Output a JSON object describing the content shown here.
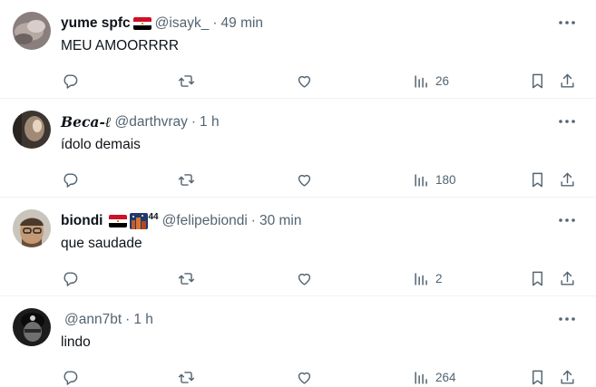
{
  "tweets": [
    {
      "name": "yume spfc",
      "handle": "@isayk_",
      "sep": "·",
      "time": "49 min",
      "text": "MEU AMOORRRR",
      "views": "26",
      "flags": [
        "egypt-flag"
      ]
    },
    {
      "name": "𝑩𝒆𝒄𝒂-ℓ",
      "handle": "@darthvray",
      "sep": "·",
      "time": "1 h",
      "text": "ídolo demais",
      "views": "180",
      "flags": []
    },
    {
      "name": "biondi",
      "handle": "@felipebiondi",
      "sep": "·",
      "time": "30 min",
      "text": "que saudade",
      "views": "2",
      "badge": "44",
      "flags": [
        "egypt-flag",
        "city-emoji"
      ]
    },
    {
      "name": "",
      "handle": "@ann7bt",
      "sep": "·",
      "time": "1 h",
      "text": "lindo",
      "views": "264",
      "flags": []
    }
  ],
  "icons": {
    "more": "more-icon",
    "reply": "reply-icon",
    "retweet": "retweet-icon",
    "like": "like-icon",
    "views": "views-icon",
    "bookmark": "bookmark-icon",
    "share": "share-icon"
  },
  "colors": {
    "text": "#0f1419",
    "secondary": "#536471",
    "divider": "#eff3f4",
    "flag_red": "#ce1126",
    "flag_white": "#ffffff",
    "flag_black": "#000000"
  }
}
